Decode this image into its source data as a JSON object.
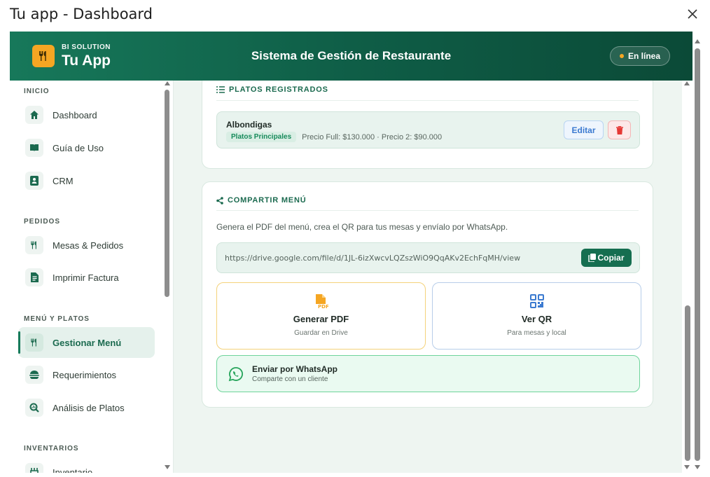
{
  "window": {
    "title": "Tu app - Dashboard"
  },
  "header": {
    "brand_sub": "BI SOLUTION",
    "brand_name": "Tu App",
    "title": "Sistema de Gestión de Restaurante",
    "status": "En línea"
  },
  "sidebar": {
    "sections": [
      {
        "label": "INICIO",
        "items": [
          {
            "label": "Dashboard",
            "icon": "home-icon"
          },
          {
            "label": "Guía de Uso",
            "icon": "book-icon"
          },
          {
            "label": "CRM",
            "icon": "contact-card-icon"
          }
        ]
      },
      {
        "label": "PEDIDOS",
        "items": [
          {
            "label": "Mesas & Pedidos",
            "icon": "utensils-icon"
          },
          {
            "label": "Imprimir Factura",
            "icon": "receipt-icon"
          }
        ]
      },
      {
        "label": "MENÚ Y PLATOS",
        "items": [
          {
            "label": "Gestionar Menú",
            "icon": "utensils-icon",
            "active": true
          },
          {
            "label": "Requerimientos",
            "icon": "burger-icon"
          },
          {
            "label": "Análisis de Platos",
            "icon": "search-chart-icon"
          }
        ]
      },
      {
        "label": "INVENTARIOS",
        "items": [
          {
            "label": "Inventario",
            "icon": "inventory-icon"
          }
        ]
      }
    ]
  },
  "dishes_card": {
    "heading": "PLATOS REGISTRADOS",
    "dishes": [
      {
        "name": "Albondigas",
        "category": "Platos Principales",
        "prices": "Precio Full: $130.000 · Precio 2: $90.000",
        "edit_label": "Editar"
      }
    ]
  },
  "share_card": {
    "heading": "COMPARTIR MENÚ",
    "description": "Genera el PDF del menú, crea el QR para tus mesas y envíalo por WhatsApp.",
    "link": "https://drive.google.com/file/d/1JL-6izXwcvLQZszWiO9QqAKv2EchFqMH/view",
    "copy_label": "Copiar",
    "pdf_title": "Generar PDF",
    "pdf_sub": "Guardar en Drive",
    "qr_title": "Ver QR",
    "qr_sub": "Para mesas y local",
    "wa_title": "Enviar por WhatsApp",
    "wa_sub": "Comparte con un cliente"
  },
  "colors": {
    "brand_green": "#167a5a",
    "accent_orange": "#f5a623",
    "danger_red": "#e53935",
    "whatsapp_green": "#25a45a"
  }
}
